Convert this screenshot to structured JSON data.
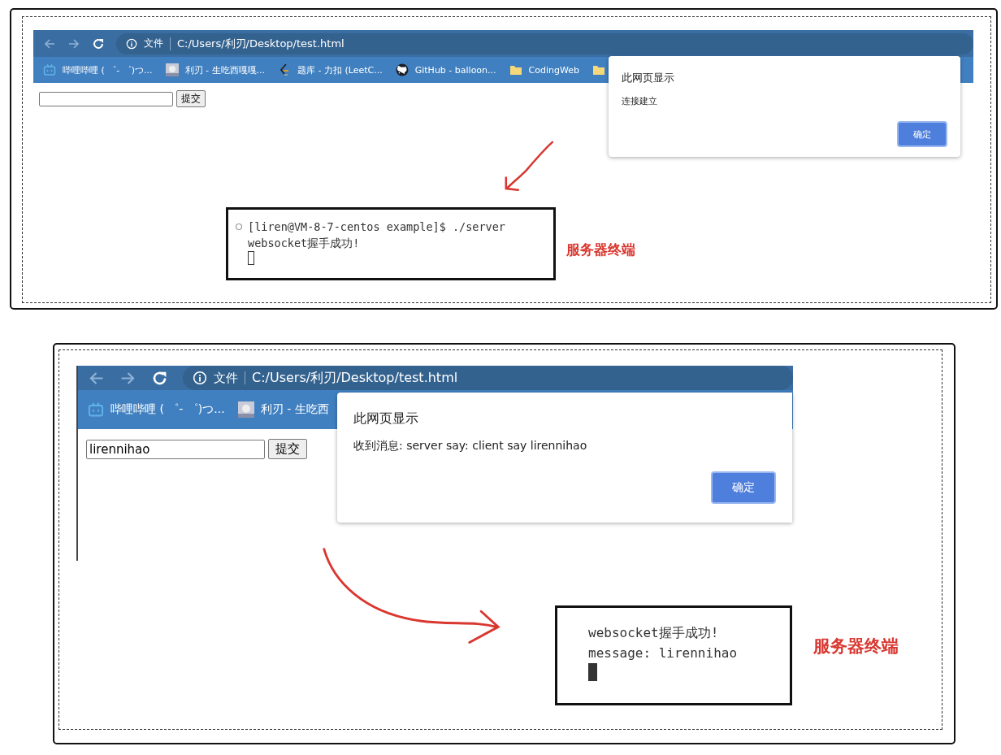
{
  "panels": [
    {
      "browser": {
        "scheme_label": "文件",
        "url": "C:/Users/利刃/Desktop/test.html",
        "bookmarks": [
          {
            "kind": "tv",
            "label": "哔哩哔哩 ( ゜- ゜)つ..."
          },
          {
            "kind": "avatar",
            "label": "利刃 - 生吃西嘎嘎..."
          },
          {
            "kind": "leetcode",
            "label": "题库 - 力扣 (LeetC..."
          },
          {
            "kind": "github",
            "label": "GitHub - balloon..."
          },
          {
            "kind": "folder",
            "label": "CodingWeb"
          },
          {
            "kind": "folder"
          }
        ],
        "form": {
          "submit_label": "提交"
        }
      },
      "dialog": {
        "title": "此网页显示",
        "message": "连接建立",
        "ok_label": "确定"
      },
      "terminal": {
        "lines": [
          {
            "text": "[liren@VM-8-7-centos example]$ ./server",
            "marker": true
          },
          {
            "text": "websocket握手成功!",
            "marker": false
          }
        ],
        "cursor_filled": false
      },
      "annotation": "服务器终端"
    },
    {
      "browser": {
        "scheme_label": "文件",
        "url": "C:/Users/利刃/Desktop/test.html",
        "bookmarks": [
          {
            "kind": "tv",
            "label": "哔哩哔哩 ( ゜- ゜)つ..."
          },
          {
            "kind": "avatar",
            "label": "利刃 - 生吃西"
          }
        ],
        "form": {
          "value": "lirennihao",
          "submit_label": "提交"
        }
      },
      "dialog": {
        "title": "此网页显示",
        "message": "收到消息: server say: client say lirennihao",
        "ok_label": "确定"
      },
      "terminal": {
        "lines": [
          {
            "text": "websocket握手成功!",
            "marker": false
          },
          {
            "text": "message: lirennihao",
            "marker": false
          }
        ],
        "cursor_filled": true
      },
      "annotation": "服务器终端"
    }
  ]
}
